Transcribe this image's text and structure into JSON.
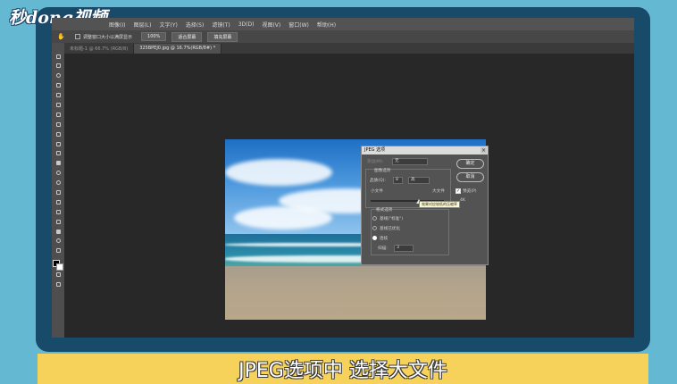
{
  "logo": {
    "text": "秒dong视频"
  },
  "menubar": {
    "items": [
      "图像(I)",
      "图层(L)",
      "文字(Y)",
      "选择(S)",
      "滤镜(T)",
      "3D(D)",
      "视图(V)",
      "窗口(W)",
      "帮助(H)"
    ]
  },
  "optionsbar": {
    "checkbox_label": "调整窗口大小以满屏显示",
    "buttons": [
      "100%",
      "适合屏幕",
      "填充屏幕"
    ]
  },
  "tabs": [
    {
      "label": "未标题-1 @ 66.7% (RGB/8)",
      "active": false
    },
    {
      "label": "325BPEJ0.jpg @ 16.7%(RGB/8#) *",
      "active": true
    }
  ],
  "dialog": {
    "title": "JPEG 选项",
    "matte_label": "杂边(M):",
    "matte_value": "无",
    "image_options_label": "图像选项",
    "quality_label": "品质(Q):",
    "quality_value": "8",
    "quality_level": "高",
    "small_file_label": "小文件",
    "large_file_label": "大文件",
    "tooltip": "效果对应较低的压缩率",
    "format_options_label": "格式选项",
    "formats": [
      {
        "label": "基线(\"标准\")",
        "selected": false
      },
      {
        "label": "基线已优化",
        "selected": false
      },
      {
        "label": "连续",
        "selected": true
      }
    ],
    "scans_label": "扫描:",
    "scans_value": "3",
    "ok_label": "确定",
    "cancel_label": "取消",
    "preview_label": "预览(P)",
    "preview_checked": true,
    "size_text": "4K"
  },
  "caption": "JPEG选项中 选择大文件"
}
